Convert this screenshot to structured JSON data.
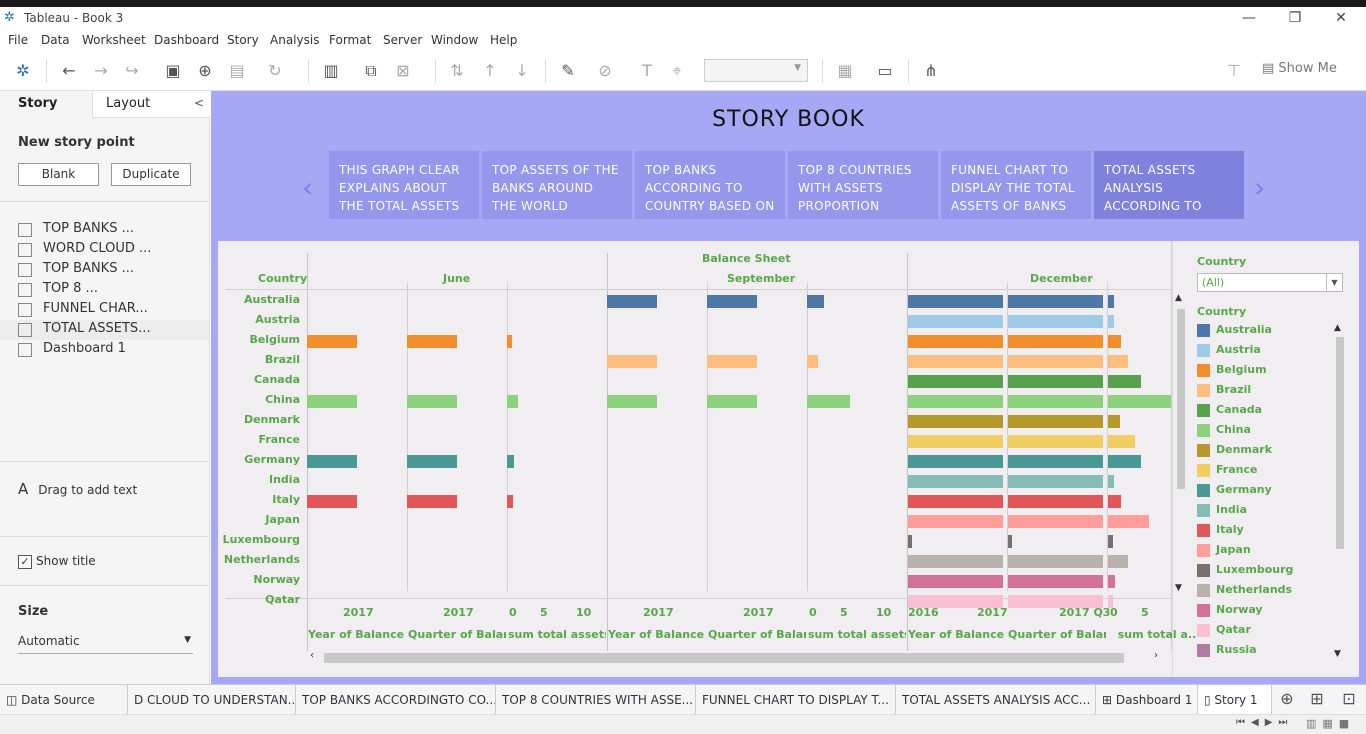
{
  "window": {
    "title": "Tableau - Book 3",
    "minimize": "—",
    "restore": "❐",
    "close": "✕"
  },
  "menu": [
    "File",
    "Data",
    "Worksheet",
    "Dashboard",
    "Story",
    "Analysis",
    "Format",
    "Server",
    "Window",
    "Help"
  ],
  "toolbar": {
    "show_me": "Show Me"
  },
  "left_pane": {
    "tab_story": "Story",
    "tab_layout": "Layout",
    "new_story_point": "New story point",
    "blank": "Blank",
    "duplicate": "Duplicate",
    "sheets": [
      "TOP BANKS ...",
      "WORD CLOUD ...",
      "TOP BANKS ...",
      "TOP 8 ...",
      "FUNNEL CHAR...",
      "TOTAL ASSETS...",
      "Dashboard 1"
    ],
    "drag_text": "Drag to add text",
    "show_title": "Show title",
    "size_heading": "Size",
    "size_value": "Automatic"
  },
  "story": {
    "title": "STORY BOOK",
    "points": [
      "THIS GRAPH CLEAR EXPLAINS ABOUT THE TOTAL ASSETS OF THE",
      "TOP ASSETS OF THE BANKS AROUND THE WORLD",
      "TOP BANKS ACCORDING TO COUNTRY BASED ON",
      "TOP 8 COUNTRIES WITH ASSETS PROPORTION",
      "FUNNEL CHART TO DISPLAY THE TOTAL ASSETS OF BANKS IN A",
      "TOTAL ASSETS ANALYSIS ACCORDING TO QUARTER AND"
    ],
    "active_point": 5
  },
  "chart_data": {
    "type": "bar",
    "title": "Balance Sheet",
    "row_header": "Country",
    "months": [
      "June",
      "September",
      "December"
    ],
    "columns": [
      {
        "month": "June",
        "label": "Year of Balance S..",
        "tick": "2017"
      },
      {
        "month": "June",
        "label": "Quarter of Balanc..",
        "tick": "2017"
      },
      {
        "month": "June",
        "label": "sum total assets",
        "ticks": [
          "0",
          "5",
          "10"
        ]
      },
      {
        "month": "September",
        "label": "Year of Balance S..",
        "tick": "2017"
      },
      {
        "month": "September",
        "label": "Quarter of Balanc..",
        "tick": "2017"
      },
      {
        "month": "September",
        "label": "sum total assets",
        "ticks": [
          "0",
          "5",
          "10"
        ]
      },
      {
        "month": "December",
        "label": "Year of Balance S..",
        "ticks": [
          "2016",
          "2017"
        ]
      },
      {
        "month": "December",
        "label": "Quarter of Balanc..",
        "tick": "2017 Q3"
      },
      {
        "month": "December",
        "label": "sum total a..",
        "ticks": [
          "0",
          "5"
        ]
      }
    ],
    "countries": [
      "Australia",
      "Austria",
      "Belgium",
      "Brazil",
      "Canada",
      "China",
      "Denmark",
      "France",
      "Germany",
      "India",
      "Italy",
      "Japan",
      "Luxembourg",
      "Netherlands",
      "Norway",
      "Qatar"
    ],
    "sum_total_assets": {
      "June": {
        "Belgium": 0.6,
        "China": 1.4,
        "Germany": 0.8,
        "Italy": 0.7
      },
      "September": {
        "Australia": 2.1,
        "Brazil": 1.4,
        "China": 5.3
      },
      "December": {
        "Australia": 0.8,
        "Austria": 0.8,
        "Belgium": 1.7,
        "Brazil": 2.6,
        "Canada": 4.3,
        "China": 8.2,
        "Denmark": 1.6,
        "France": 3.5,
        "Germany": 4.3,
        "India": 0.8,
        "Italy": 1.7,
        "Japan": 5.4,
        "Luxembourg": 0.7,
        "Netherlands": 2.6,
        "Norway": 0.9,
        "Qatar": 0.6
      }
    },
    "filter": {
      "label": "Country",
      "value": "(All)"
    },
    "legend_title": "Country",
    "legend": [
      {
        "name": "Australia",
        "color": "#4e79a7"
      },
      {
        "name": "Austria",
        "color": "#a0cbe8"
      },
      {
        "name": "Belgium",
        "color": "#f28e2b"
      },
      {
        "name": "Brazil",
        "color": "#ffbe7d"
      },
      {
        "name": "Canada",
        "color": "#59a14f"
      },
      {
        "name": "China",
        "color": "#8cd17d"
      },
      {
        "name": "Denmark",
        "color": "#b6992d"
      },
      {
        "name": "France",
        "color": "#f1ce63"
      },
      {
        "name": "Germany",
        "color": "#499894"
      },
      {
        "name": "India",
        "color": "#86bcb6"
      },
      {
        "name": "Italy",
        "color": "#e15759"
      },
      {
        "name": "Japan",
        "color": "#ff9d9a"
      },
      {
        "name": "Luxembourg",
        "color": "#79706e"
      },
      {
        "name": "Netherlands",
        "color": "#bab0ac"
      },
      {
        "name": "Norway",
        "color": "#d37295"
      },
      {
        "name": "Qatar",
        "color": "#fabfd2"
      },
      {
        "name": "Russia",
        "color": "#b07aa1"
      }
    ]
  },
  "bottom_tabs": [
    "Data Source",
    "D CLOUD TO UNDERSTAN...",
    "TOP BANKS ACCORDINGTO CO...",
    "TOP 8 COUNTRIES WITH ASSE...",
    "FUNNEL CHART TO DISPLAY T...",
    "TOTAL ASSETS ANALYSIS ACC...",
    "Dashboard 1",
    "Story 1"
  ],
  "active_tab": "Story 1"
}
